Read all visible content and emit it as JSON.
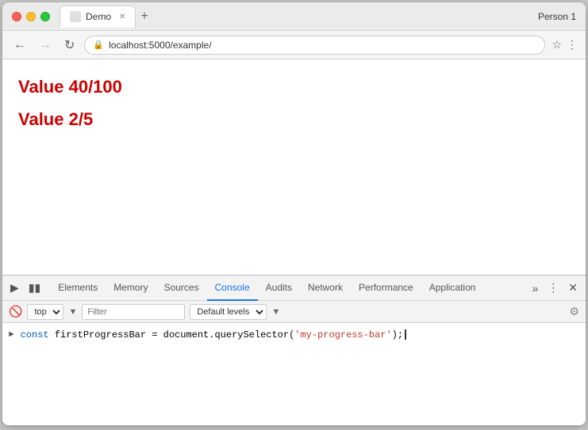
{
  "window": {
    "title": "Demo",
    "url": "localhost:5000/example/",
    "user": "Person 1"
  },
  "page": {
    "value1": "Value 40/100",
    "value2": "Value 2/5"
  },
  "devtools": {
    "tabs": [
      {
        "label": "Elements",
        "active": false
      },
      {
        "label": "Memory",
        "active": false
      },
      {
        "label": "Sources",
        "active": false
      },
      {
        "label": "Console",
        "active": true
      },
      {
        "label": "Audits",
        "active": false
      },
      {
        "label": "Network",
        "active": false
      },
      {
        "label": "Performance",
        "active": false
      },
      {
        "label": "Application",
        "active": false
      }
    ],
    "toolbar": {
      "context": "top",
      "filter_placeholder": "Filter",
      "levels": "Default levels"
    },
    "console": {
      "line": "const firstProgressBar = document.querySelector('my-progress-bar');"
    }
  }
}
